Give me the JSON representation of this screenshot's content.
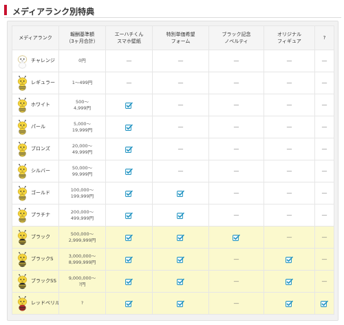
{
  "title": "メディアランク別特典",
  "headers": [
    [
      "メディアランク"
    ],
    [
      "報酬基準額",
      "（3ヶ月合計）"
    ],
    [
      "エーハチくん",
      "スマホ壁紙"
    ],
    [
      "特別単価希望",
      "フォーム"
    ],
    [
      "ブラック記念",
      "ノベルティ"
    ],
    [
      "オリジナル",
      "フィギュア"
    ],
    [
      "?"
    ]
  ],
  "dash": "—",
  "check_icon": "check-icon",
  "colors": {
    "accent": "#c8102e",
    "highlight_row": "#fbf9cd",
    "check": "#1a8fbf"
  },
  "rows": [
    {
      "rank": "チャレンジ",
      "amount": [
        "0円"
      ],
      "mascot": "plain-egg",
      "highlight": false,
      "cells": [
        "dash",
        "dash",
        "dash",
        "dash",
        "dash"
      ]
    },
    {
      "rank": "レギュラー",
      "amount": [
        "1〜499円"
      ],
      "mascot": "bee",
      "highlight": false,
      "cells": [
        "dash",
        "dash",
        "dash",
        "dash",
        "dash"
      ]
    },
    {
      "rank": "ホワイト",
      "amount": [
        "500〜",
        "4,999円"
      ],
      "mascot": "bee",
      "highlight": false,
      "cells": [
        "check",
        "dash",
        "dash",
        "dash",
        "dash"
      ]
    },
    {
      "rank": "パール",
      "amount": [
        "5,000〜",
        "19,999円"
      ],
      "mascot": "bee",
      "highlight": false,
      "cells": [
        "check",
        "dash",
        "dash",
        "dash",
        "dash"
      ]
    },
    {
      "rank": "ブロンズ",
      "amount": [
        "20,000〜",
        "49,999円"
      ],
      "mascot": "bee",
      "highlight": false,
      "cells": [
        "check",
        "dash",
        "dash",
        "dash",
        "dash"
      ]
    },
    {
      "rank": "シルバー",
      "amount": [
        "50,000〜",
        "99,999円"
      ],
      "mascot": "bee",
      "highlight": false,
      "cells": [
        "check",
        "dash",
        "dash",
        "dash",
        "dash"
      ]
    },
    {
      "rank": "ゴールド",
      "amount": [
        "100,000〜",
        "199,999円"
      ],
      "mascot": "bee",
      "highlight": false,
      "cells": [
        "check",
        "check",
        "dash",
        "dash",
        "dash"
      ]
    },
    {
      "rank": "プラチナ",
      "amount": [
        "200,000〜",
        "499,999円"
      ],
      "mascot": "bee",
      "highlight": false,
      "cells": [
        "check",
        "check",
        "dash",
        "dash",
        "dash"
      ]
    },
    {
      "rank": "ブラック",
      "amount": [
        "500,000〜",
        "2,999,999円"
      ],
      "mascot": "bee-black",
      "highlight": true,
      "cells": [
        "check",
        "check",
        "check",
        "dash",
        "dash"
      ]
    },
    {
      "rank": "ブラックS",
      "amount": [
        "3,000,000〜",
        "8,999,999円"
      ],
      "mascot": "bee-black",
      "highlight": true,
      "cells": [
        "check",
        "check",
        "dash",
        "check",
        "dash"
      ]
    },
    {
      "rank": "ブラックSS",
      "amount": [
        "9,000,000〜",
        "?円"
      ],
      "mascot": "bee-black",
      "highlight": true,
      "cells": [
        "check",
        "check",
        "dash",
        "check",
        "dash"
      ]
    },
    {
      "rank": "レッドベリル",
      "amount": [
        "?"
      ],
      "mascot": "bee-red",
      "highlight": true,
      "cells": [
        "check",
        "check",
        "dash",
        "check",
        "check"
      ]
    }
  ]
}
